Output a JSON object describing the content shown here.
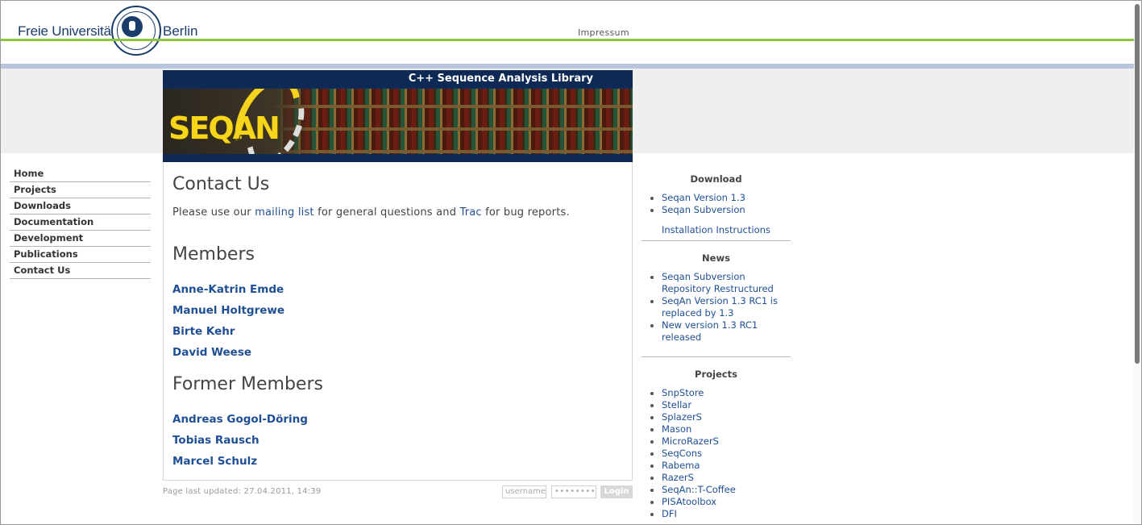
{
  "header": {
    "university_left": "Freie Universität",
    "university_right": "Berlin",
    "impressum": "Impressum"
  },
  "banner": {
    "title": "C++ Sequence Analysis Library",
    "logo_text": "SEQAN"
  },
  "nav": {
    "items": [
      {
        "label": "Home"
      },
      {
        "label": "Projects"
      },
      {
        "label": "Downloads"
      },
      {
        "label": "Documentation"
      },
      {
        "label": "Development"
      },
      {
        "label": "Publications"
      },
      {
        "label": "Contact Us"
      }
    ]
  },
  "main": {
    "title": "Contact Us",
    "intro_pre": "Please use our ",
    "intro_link1": "mailing list",
    "intro_mid": " for general questions and ",
    "intro_link2": "Trac",
    "intro_post": " for bug reports.",
    "members_heading": "Members",
    "members": [
      "Anne-Katrin Emde",
      "Manuel Holtgrewe",
      "Birte Kehr",
      "David Weese"
    ],
    "former_heading": "Former Members",
    "former_members": [
      "Andreas Gogol-Döring",
      "Tobias Rausch",
      "Marcel Schulz"
    ]
  },
  "footer": {
    "updated": "Page last updated: 27.04.2011, 14:39",
    "username_placeholder": "username",
    "password_placeholder": "••••••••",
    "login_label": "Login"
  },
  "sidebar": {
    "download_heading": "Download",
    "download_items": [
      "Seqan Version 1.3",
      "Seqan Subversion"
    ],
    "install_link": "Installation Instructions",
    "news_heading": "News",
    "news_items": [
      "Seqan Subversion Repository Restructured",
      "SeqAn Version 1.3 RC1 is replaced by 1.3",
      "New version 1.3 RC1 released"
    ],
    "projects_heading": "Projects",
    "project_items": [
      "SnpStore",
      "Stellar",
      "SplazerS",
      "Mason",
      "MicroRazerS",
      "SeqCons",
      "Rabema",
      "RazerS",
      "SeqAn::T-Coffee",
      "PISAtoolbox",
      "DFI"
    ]
  },
  "colors": {
    "link": "#1f4f94",
    "fu_green": "#8cc63f",
    "fu_blue": "#1a3c6a",
    "banner_navy": "#0e2a54",
    "seqan_yellow": "#f7d51a"
  }
}
